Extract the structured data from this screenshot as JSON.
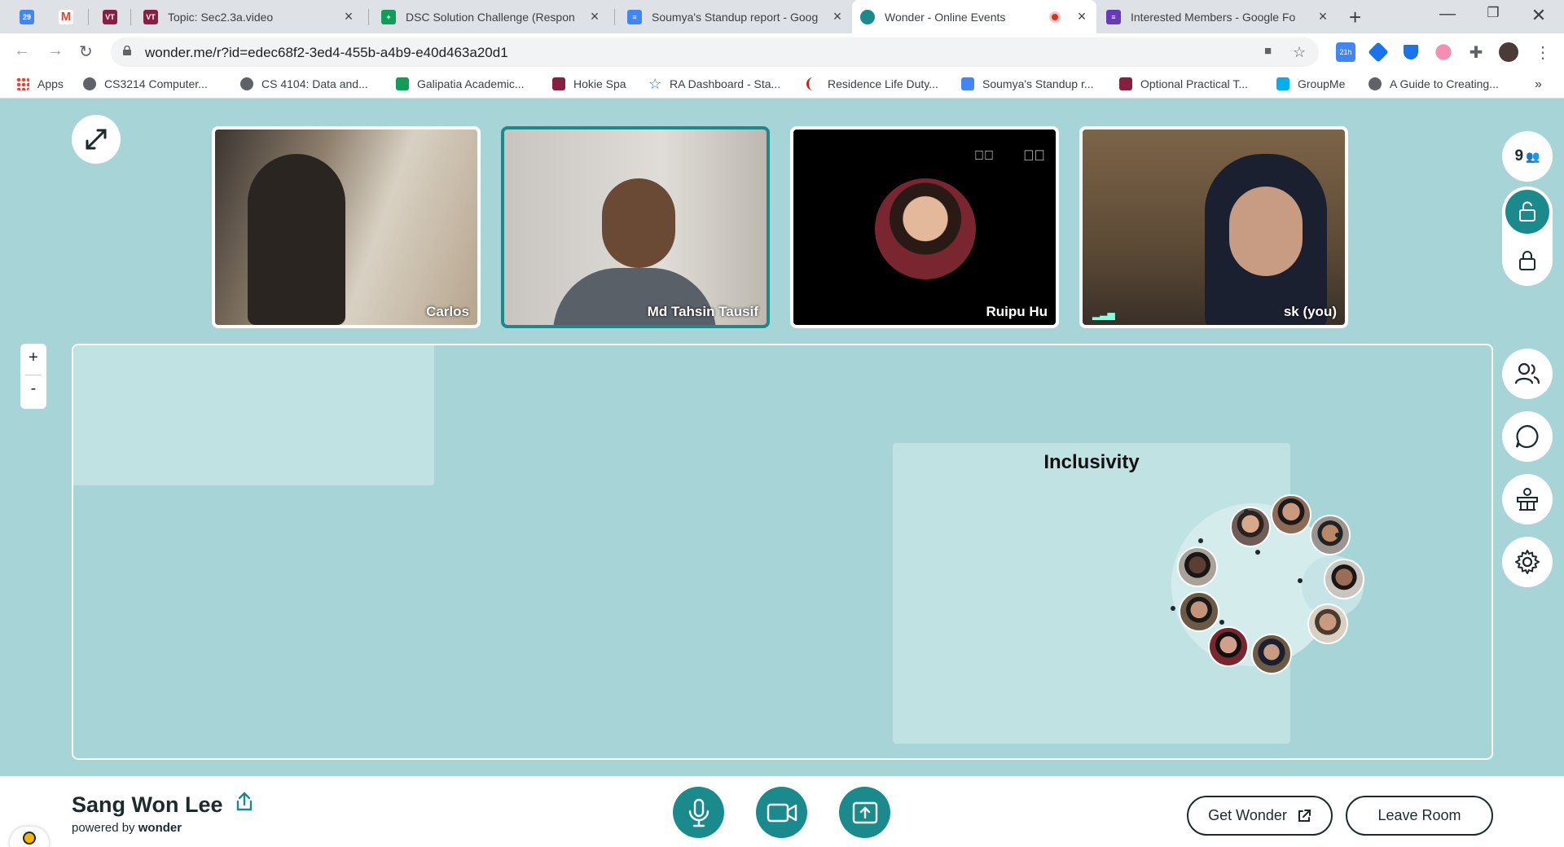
{
  "browser": {
    "tabs": [
      {
        "label": "",
        "icon": "google-calendar-icon",
        "color": "#4285f4"
      },
      {
        "label": "",
        "icon": "gmail-icon",
        "color": "#ea4335"
      },
      {
        "label": "",
        "icon": "virginia-tech-icon",
        "color": "#861f41"
      },
      {
        "label": "Topic: Sec2.3a.video",
        "icon": "virginia-tech-icon",
        "color": "#861f41"
      },
      {
        "label": "DSC Solution Challenge (Respon",
        "icon": "google-sheets-icon",
        "color": "#0f9d58"
      },
      {
        "label": "Soumya's Standup report - Goog",
        "icon": "google-docs-icon",
        "color": "#4285f4"
      },
      {
        "label": "Wonder - Online Events",
        "icon": "wonder-icon",
        "color": "#1b8a8c"
      },
      {
        "label": "Interested Members - Google Fo",
        "icon": "google-forms-icon",
        "color": "#673ab7"
      }
    ],
    "url": "wonder.me/r?id=edec68f2-3ed4-455b-a4b9-e40d463a20d1",
    "extension_badge": "21h",
    "bookmarks": [
      {
        "label": "Apps",
        "color": "#4285f4"
      },
      {
        "label": "CS3214 Computer...",
        "color": "#5f6368"
      },
      {
        "label": "CS 4104: Data and...",
        "color": "#5f6368"
      },
      {
        "label": "Galipatia Academic...",
        "color": "#0f9d58"
      },
      {
        "label": "Hokie Spa",
        "color": "#861f41"
      },
      {
        "label": "RA Dashboard - Sta...",
        "color": "#1a73e8"
      },
      {
        "label": "Residence Life Duty...",
        "color": "#c5221f"
      },
      {
        "label": "Soumya's Standup r...",
        "color": "#4285f4"
      },
      {
        "label": "Optional Practical T...",
        "color": "#861f41"
      },
      {
        "label": "GroupMe",
        "color": "#00aff0"
      },
      {
        "label": "A Guide to Creating...",
        "color": "#5f6368"
      }
    ]
  },
  "wonder": {
    "participant_count": "9",
    "videos": [
      {
        "name": "Carlos",
        "bg": "#8a7d6d",
        "speaking": false
      },
      {
        "name": "Md Tahsin Tausif",
        "bg": "#b7b3ad",
        "speaking": true
      },
      {
        "name": "Ruipu Hu",
        "bg": "#000000",
        "speaking": false
      },
      {
        "name": "sk (you)",
        "bg": "#6c5a45",
        "speaking": false
      }
    ],
    "zoom": {
      "in": "+",
      "out": "-"
    },
    "area_title": "Inclusivity",
    "user_name": "Sang Won Lee",
    "powered_by_prefix": "powered by",
    "powered_by_brand": "wonder",
    "get_wonder_label": "Get Wonder",
    "leave_room_label": "Leave Room",
    "colors": {
      "accent": "#1b8a8c",
      "background": "#a7d5d7",
      "area": "#c0e2e3"
    }
  }
}
